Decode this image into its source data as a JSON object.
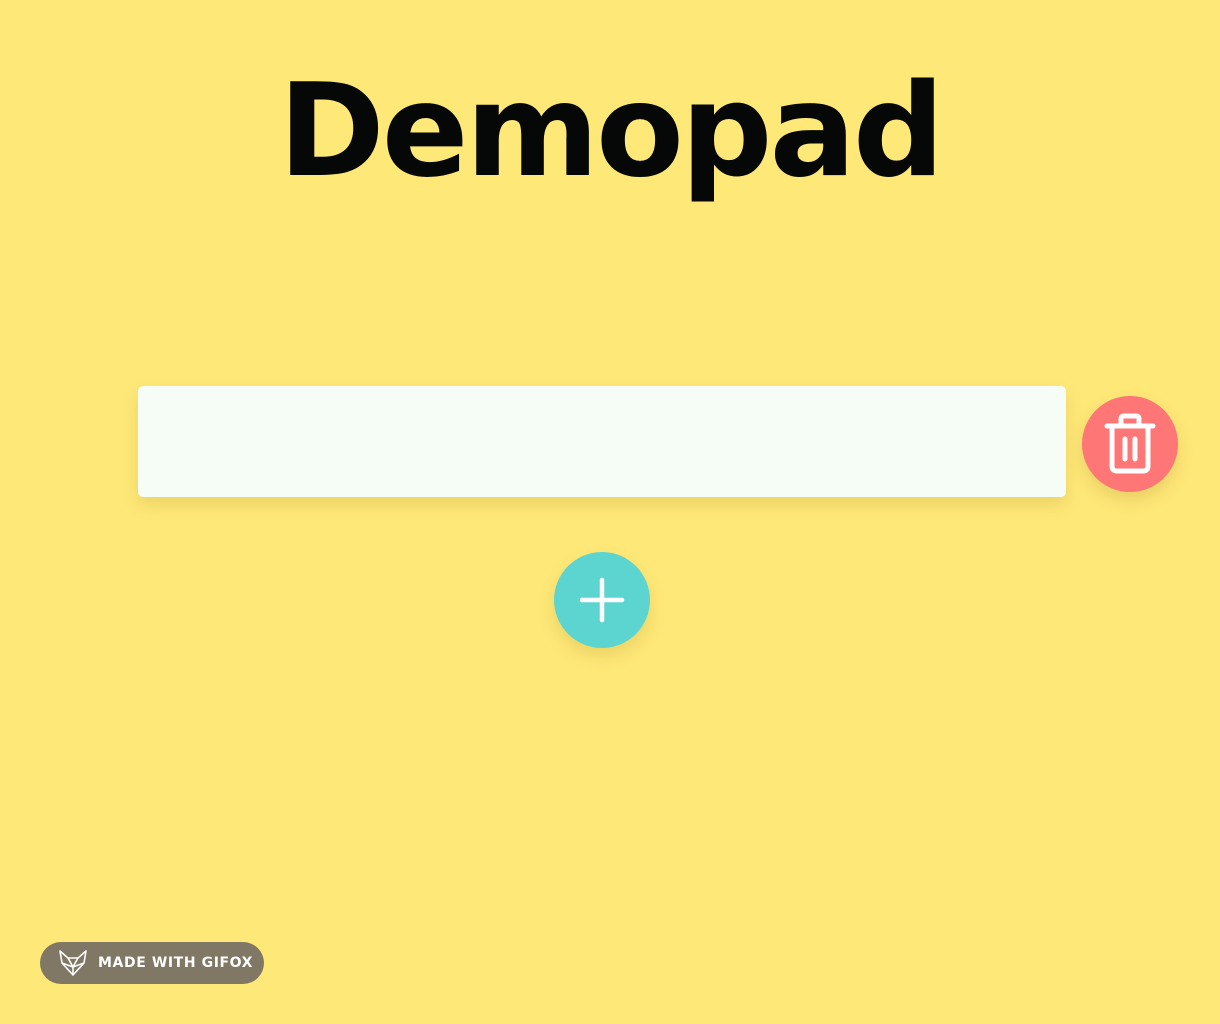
{
  "app": {
    "title": "Demopad"
  },
  "note": {
    "value": ""
  },
  "actions": {
    "delete_icon": "trash-icon",
    "add_icon": "plus-icon"
  },
  "badge": {
    "icon": "fox-icon",
    "label": "MADE WITH GIFOX"
  },
  "colors": {
    "background": "#fee878",
    "note": "#f6fdf7",
    "delete": "#fe7676",
    "add": "#5cd5d0",
    "title": "#050806",
    "badge": "#807764"
  }
}
